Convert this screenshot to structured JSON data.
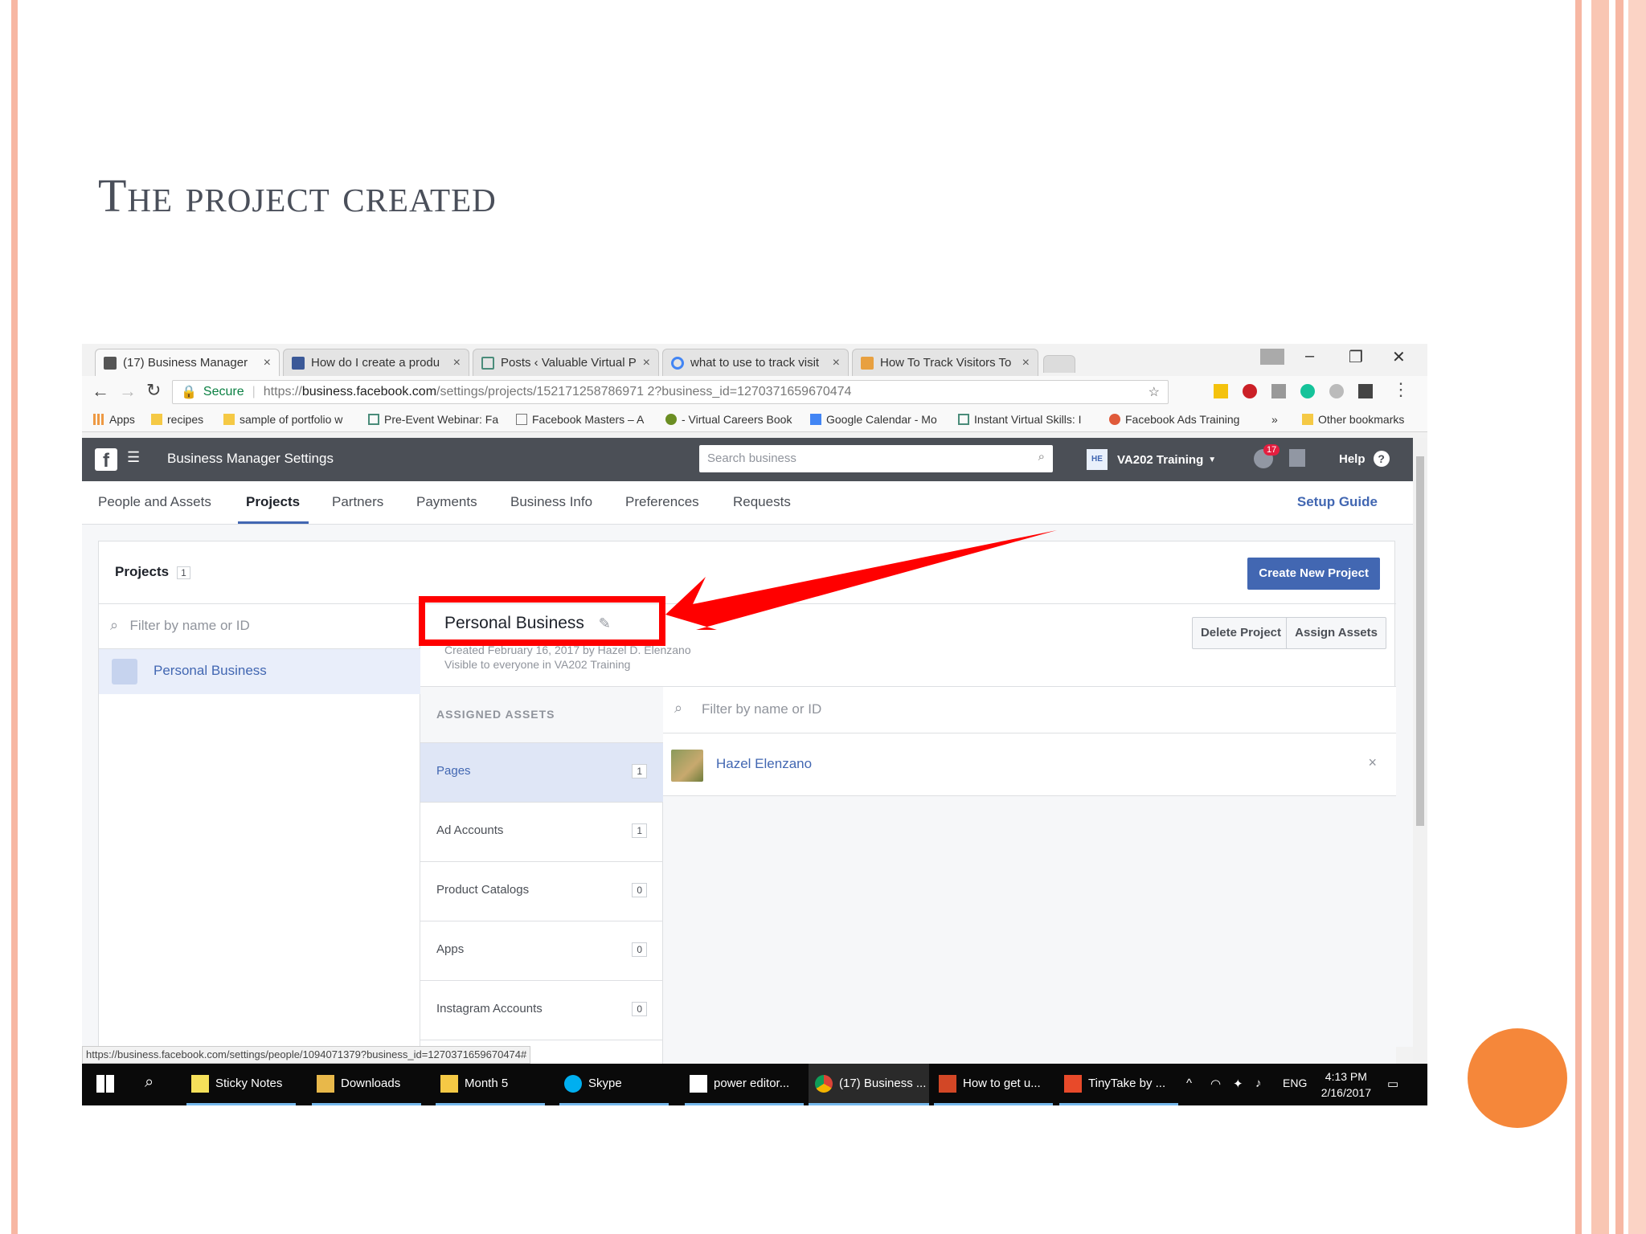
{
  "slide": {
    "title": "The project created",
    "colors": {
      "stripe": "#f7b7a3",
      "dot": "#f5873a",
      "fb_header": "#4b4f56",
      "fb_blue": "#4267b2",
      "annotation": "#ff0000"
    }
  },
  "browser": {
    "tabs": [
      {
        "label": "(17) Business Manager",
        "icon": "business-manager-icon",
        "active": true
      },
      {
        "label": "How do I create a produ",
        "icon": "facebook-icon"
      },
      {
        "label": "Posts ‹ Valuable Virtual P",
        "icon": "hub-icon"
      },
      {
        "label": "what to use to track visit",
        "icon": "google-icon"
      },
      {
        "label": "How To Track Visitors To",
        "icon": "site-icon"
      }
    ],
    "address": {
      "secure_label": "Secure",
      "url_prefix": "https://",
      "url_host": "business.facebook.com",
      "url_path": "/settings/projects/152171258786971 2?business_id=1270371659670474"
    },
    "bookmarks": [
      "Apps",
      "recipes",
      "sample of portfolio w",
      "Pre-Event Webinar: Fa",
      "Facebook Masters – A",
      "- Virtual Careers Book",
      "Google Calendar - Mo",
      "Instant Virtual Skills: I",
      "Facebook Ads Training",
      "»",
      "Other bookmarks"
    ],
    "status_url": "https://business.facebook.com/settings/people/1094071379?business_id=1270371659670474#"
  },
  "fb": {
    "header_title": "Business Manager Settings",
    "search_placeholder": "Search business",
    "account_initials": "HE",
    "account_name": "VA202 Training",
    "notification_count": "17",
    "help_label": "Help",
    "nav": [
      "People and Assets",
      "Projects",
      "Partners",
      "Payments",
      "Business Info",
      "Preferences",
      "Requests"
    ],
    "nav_active": "Projects",
    "setup_guide": "Setup Guide",
    "projects_title": "Projects",
    "projects_count": "1",
    "create_button": "Create New Project",
    "left_filter_placeholder": "Filter by name or ID",
    "selected_project": "Personal Business",
    "detail": {
      "name": "Personal Business",
      "created": "Created February 16, 2017 by Hazel D. Elenzano",
      "visibility": "Visible to everyone in VA202 Training",
      "delete_button": "Delete Project",
      "assign_button": "Assign Assets",
      "assigned_header": "ASSIGNED ASSETS",
      "assets": [
        {
          "label": "Pages",
          "count": "1",
          "selected": true
        },
        {
          "label": "Ad Accounts",
          "count": "1"
        },
        {
          "label": "Product Catalogs",
          "count": "0"
        },
        {
          "label": "Apps",
          "count": "0"
        },
        {
          "label": "Instagram Accounts",
          "count": "0"
        }
      ],
      "right_filter_placeholder": "Filter by name or ID",
      "person": "Hazel Elenzano",
      "remove": "×"
    }
  },
  "taskbar": {
    "items": [
      "Sticky Notes",
      "Downloads",
      "Month 5",
      "Skype",
      "power editor...",
      "(17) Business ...",
      "How to get u...",
      "TinyTake by ..."
    ],
    "lang": "ENG",
    "time": "4:13 PM",
    "date": "2/16/2017"
  }
}
